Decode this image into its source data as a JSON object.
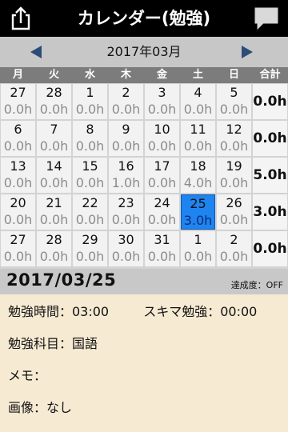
{
  "header": {
    "title": "カレンダー(勉強)",
    "left_icon": "share-icon",
    "right_icon": "chat-bubble-icon"
  },
  "month_nav": {
    "label": "2017年03月"
  },
  "weekdays": [
    "月",
    "火",
    "水",
    "木",
    "金",
    "土",
    "日"
  ],
  "total_header": "合計",
  "weeks": [
    {
      "days": [
        {
          "day": "27",
          "hours": "0.0h"
        },
        {
          "day": "28",
          "hours": "0.0h"
        },
        {
          "day": "1",
          "hours": "0.0h"
        },
        {
          "day": "2",
          "hours": "0.0h"
        },
        {
          "day": "3",
          "hours": "0.0h"
        },
        {
          "day": "4",
          "hours": "0.0h"
        },
        {
          "day": "5",
          "hours": "0.0h"
        }
      ],
      "total": "0.0h"
    },
    {
      "days": [
        {
          "day": "6",
          "hours": "0.0h"
        },
        {
          "day": "7",
          "hours": "0.0h"
        },
        {
          "day": "8",
          "hours": "0.0h"
        },
        {
          "day": "9",
          "hours": "0.0h"
        },
        {
          "day": "10",
          "hours": "0.0h"
        },
        {
          "day": "11",
          "hours": "0.0h"
        },
        {
          "day": "12",
          "hours": "0.0h"
        }
      ],
      "total": "0.0h"
    },
    {
      "days": [
        {
          "day": "13",
          "hours": "0.0h"
        },
        {
          "day": "14",
          "hours": "0.0h"
        },
        {
          "day": "15",
          "hours": "0.0h"
        },
        {
          "day": "16",
          "hours": "1.0h"
        },
        {
          "day": "17",
          "hours": "0.0h"
        },
        {
          "day": "18",
          "hours": "4.0h"
        },
        {
          "day": "19",
          "hours": "0.0h"
        }
      ],
      "total": "5.0h"
    },
    {
      "days": [
        {
          "day": "20",
          "hours": "0.0h"
        },
        {
          "day": "21",
          "hours": "0.0h"
        },
        {
          "day": "22",
          "hours": "0.0h"
        },
        {
          "day": "23",
          "hours": "0.0h"
        },
        {
          "day": "24",
          "hours": "0.0h"
        },
        {
          "day": "25",
          "hours": "3.0h",
          "selected": true
        },
        {
          "day": "26",
          "hours": "0.0h"
        }
      ],
      "total": "3.0h"
    },
    {
      "days": [
        {
          "day": "27",
          "hours": "0.0h"
        },
        {
          "day": "28",
          "hours": "0.0h"
        },
        {
          "day": "29",
          "hours": "0.0h"
        },
        {
          "day": "30",
          "hours": "0.0h"
        },
        {
          "day": "31",
          "hours": "0.0h"
        },
        {
          "day": "1",
          "hours": "0.0h"
        },
        {
          "day": "2",
          "hours": "0.0h"
        }
      ],
      "total": "0.0h"
    }
  ],
  "selected": {
    "date": "2017/03/25",
    "achievement": "達成度：OFF"
  },
  "details": {
    "study_time": "勉強時間：03:00",
    "spare_time": "スキマ勉強：00:00",
    "subject": "勉強科目：国語",
    "memo": "メモ：",
    "image": "画像：なし"
  },
  "colors": {
    "selected": "#1e84f0",
    "nav_arrow": "#2c4b77",
    "background": "#f6ead3"
  }
}
